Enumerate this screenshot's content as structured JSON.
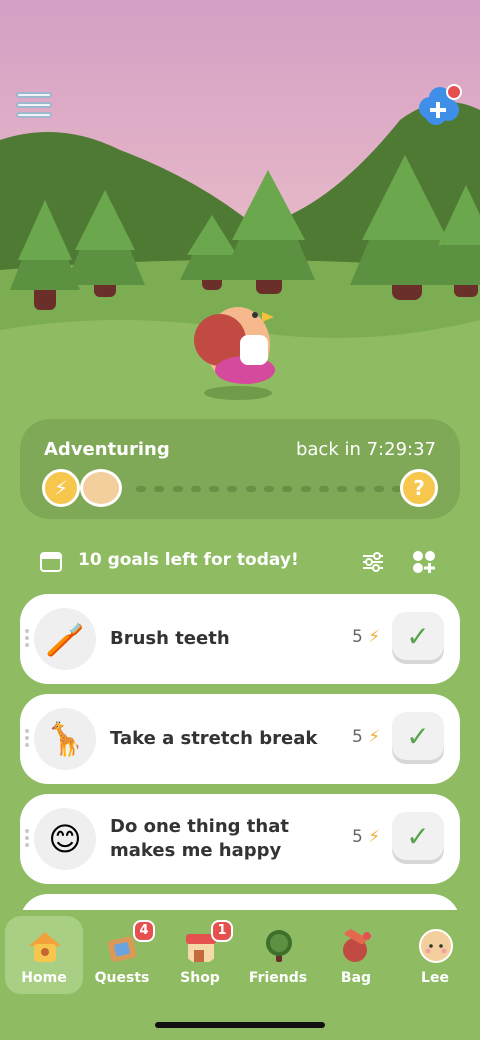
{
  "adventure": {
    "title": "Adventuring",
    "timer": "back in 7:29:37",
    "energy_icon": "lightning-icon",
    "help_label": "?"
  },
  "goals_header": {
    "text": "10 goals left for today!"
  },
  "goals": [
    {
      "label": "Brush teeth",
      "energy": "5",
      "icon": "toothbrush-icon"
    },
    {
      "label": "Take a stretch break",
      "energy": "5",
      "icon": "giraffe-icon"
    },
    {
      "label": "Do one thing that makes me happy",
      "energy": "5",
      "icon": "smiling-face-icon"
    }
  ],
  "nav": {
    "items": [
      {
        "label": "Home",
        "icon": "house-icon",
        "active": true
      },
      {
        "label": "Quests",
        "icon": "quest-box-icon",
        "badge": "4"
      },
      {
        "label": "Shop",
        "icon": "shop-icon",
        "badge": "1"
      },
      {
        "label": "Friends",
        "icon": "tree-icon"
      },
      {
        "label": "Bag",
        "icon": "bag-icon"
      },
      {
        "label": "Lee",
        "icon": "avatar-icon"
      }
    ]
  },
  "colors": {
    "sky_top": "#d7a3c6",
    "sky_bottom": "#f4c8cc",
    "grass": "#8fbc63",
    "card_green": "#7fa956",
    "energy_yellow": "#f6c64d",
    "check_green": "#5aa34d",
    "badge_red": "#e4514f"
  }
}
